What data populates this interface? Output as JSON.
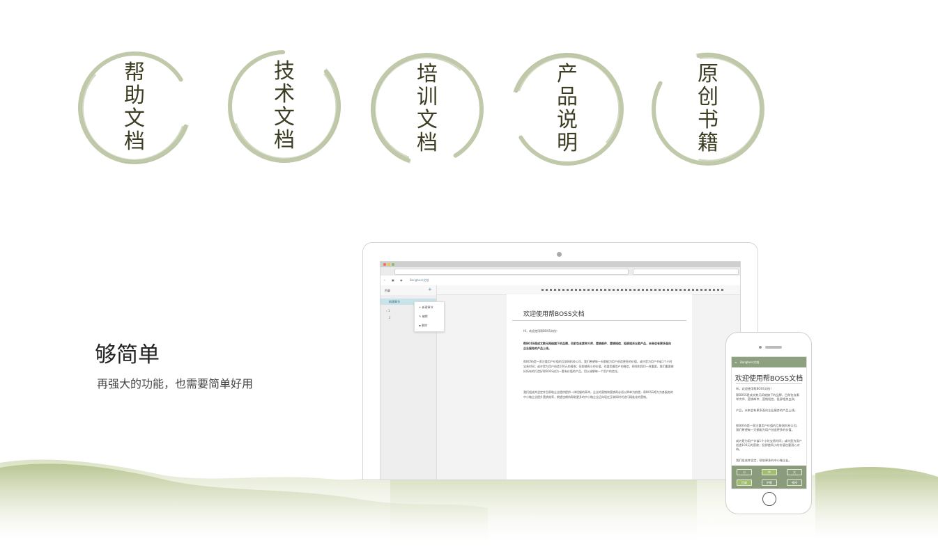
{
  "categories": [
    {
      "id": "help",
      "label": [
        "帮",
        "助",
        "文",
        "档"
      ]
    },
    {
      "id": "tech",
      "label": [
        "技",
        "术",
        "文",
        "档"
      ]
    },
    {
      "id": "training",
      "label": [
        "培",
        "训",
        "文",
        "档"
      ]
    },
    {
      "id": "product",
      "label": [
        "产",
        "品",
        "说",
        "明"
      ]
    },
    {
      "id": "original",
      "label": [
        "原",
        "创",
        "书",
        "籍"
      ]
    }
  ],
  "slogan": {
    "title": "够简单",
    "subtitle": "再强大的功能，也需要简单好用"
  },
  "laptop_app": {
    "app_name": "Bangboss文档",
    "sidebar": {
      "title": "目录",
      "add": "+",
      "selected_node": "新建章节",
      "nodes": [
        "1",
        "2"
      ]
    },
    "context_menu": [
      "新建章节",
      "编辑",
      "删除"
    ],
    "document": {
      "title": "欢迎使用帮BOSS文档",
      "paragraphs": [
        "Hi，欢迎使用帮BOSS文档！",
        "帮BOSS是成文数元网络旗下的品牌，目前包含素举大师、营销邮件、营销短信、投屏相关五款产品，未来会有更多面向企业服务的产品上线。",
        "帮BOSS是一家注重用户价值的互联网科技公司，我们希望每一天都能为用户创造更多的价值，或许是为用户节省1个小时宝贵时间；或许是为用户创造100元的营收；但即使再小的价值，也要用最用户的微信，把住和我们一样重要，我们重要做好所有的打造好帮BOSS成为一套有价值的产品，用以诚挚每一个用户的信任。",
        "我们组成并坚定并且帮助企业提供提供一体话服的革命，企业的营销和营销帮必须以简单为前提，帮BOSS将为为各服务的中小微企业提升营销效率，期望也期待帮助更多的中小微企业迈向现在互联网时代进行精准化的营销。"
      ]
    },
    "colors": {
      "sidebar_selected": "#c8e3ea"
    }
  },
  "phone_app": {
    "app_name": "Bangboss文档",
    "title": "欢迎使用帮BOSS文档",
    "paragraphs": [
      "Hi，欢迎使用帮BOSS文档！",
      "帮BOSS是成文数元网络旗下的品牌，目前包含素举大师、营销邮件、营销短信、投屏相关五款。",
      "产品，未来会有更多面向企业服务的产品上线。",
      "帮BOSS是一家注重用户价值的互联网科技公司，我们希望每一天都能为用户创造更多的价值。",
      "或许是为用户节省1个小时宝贵时间；或许是为用户创造100元的营收；但即使再小的价值也要用心对待。",
      "我们组成并坚定，帮助更多的中小微企业。"
    ],
    "buttons_row1": [
      "小",
      "中",
      "大"
    ],
    "buttons_row2": [
      "目录",
      "护眼",
      "夜间"
    ],
    "colors": {
      "bar": "#8da080",
      "bottom": "#8a9c7c"
    }
  },
  "theme": {
    "accent": "#8da080",
    "brush": "#b6bf9c",
    "hills": "#c4cfa3"
  }
}
